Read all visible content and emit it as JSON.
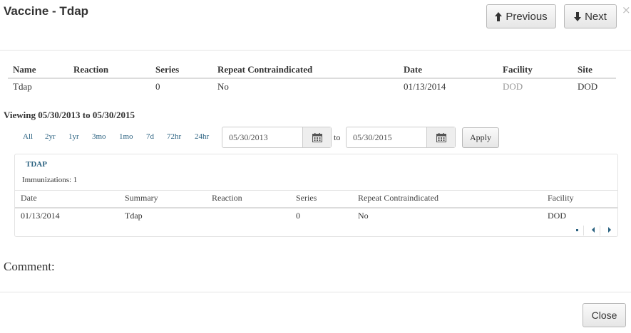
{
  "modal": {
    "title": "Vaccine - Tdap",
    "previous_label": "Previous",
    "next_label": "Next",
    "close_x": "×"
  },
  "vaccine_table": {
    "headers": [
      "Name",
      "Reaction",
      "Series",
      "Repeat Contraindicated",
      "Date",
      "Facility",
      "Site"
    ],
    "row": [
      "Tdap",
      "",
      "0",
      "No",
      "01/13/2014",
      "DOD",
      "DOD"
    ]
  },
  "viewing": "Viewing 05/30/2013 to 05/30/2015",
  "ranges": [
    "All",
    "2yr",
    "1yr",
    "3mo",
    "1mo",
    "7d",
    "72hr",
    "24hr"
  ],
  "date_from": "05/30/2013",
  "to_label": "to",
  "date_to": "05/30/2015",
  "apply_label": "Apply",
  "panel": {
    "title": "TDAP",
    "count_text": "Immunizations: 1",
    "headers": [
      "Date",
      "Summary",
      "Reaction",
      "Series",
      "Repeat Contraindicated",
      "Facility"
    ],
    "row": [
      "01/13/2014",
      "Tdap",
      "",
      "0",
      "No",
      "DOD"
    ]
  },
  "comment_label": "Comment:",
  "close_label": "Close",
  "icons": [
    "arrow-up-icon",
    "arrow-down-icon",
    "calendar-icon",
    "caret-left-icon",
    "caret-right-icon"
  ]
}
